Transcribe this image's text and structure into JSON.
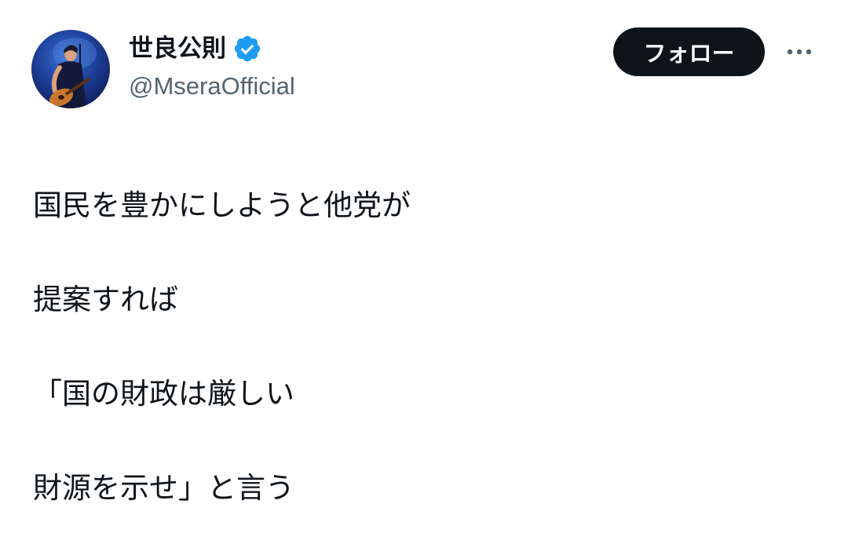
{
  "author": {
    "display_name": "世良公則",
    "handle": "@MseraOfficial",
    "verified": true,
    "verified_color": "#1d9bf0"
  },
  "actions": {
    "follow_label": "フォロー",
    "more_icon": "more-horizontal-icon"
  },
  "tweet": {
    "lines": [
      "国民を豊かにしようと他党が",
      "提案すれば",
      "「国の財政は厳しい",
      "財源を示せ」と言う"
    ]
  },
  "colors": {
    "text_primary": "#0f1419",
    "text_secondary": "#536471",
    "button_bg": "#0f1419",
    "button_text": "#ffffff"
  }
}
